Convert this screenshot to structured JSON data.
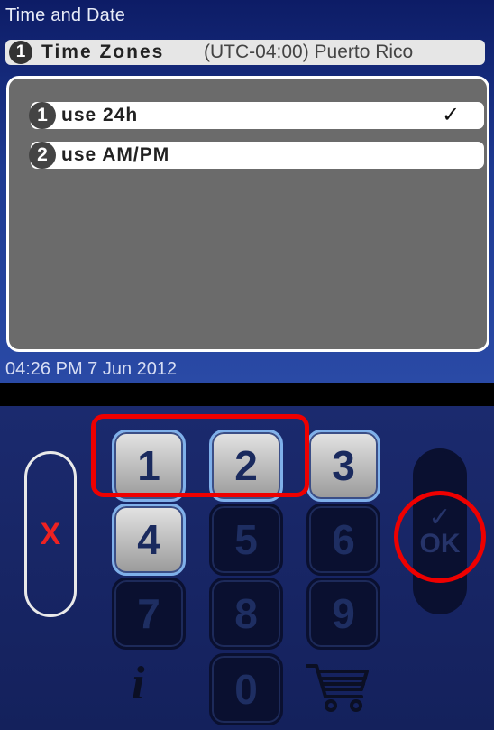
{
  "header": {
    "title": "Time and Date"
  },
  "timezone": {
    "number": "1",
    "label": "Time Zones",
    "value": "(UTC-04:00) Puerto Rico"
  },
  "dialog": {
    "options": [
      {
        "number": "1",
        "label": "use 24h",
        "checked": true,
        "check": "✓"
      },
      {
        "number": "2",
        "label": "use AM/PM",
        "checked": false
      }
    ]
  },
  "status": {
    "datetime": "04:26 PM 7 Jun 2012"
  },
  "keypad": {
    "keys": {
      "k1": "1",
      "k2": "2",
      "k3": "3",
      "k4": "4",
      "k5": "5",
      "k6": "6",
      "k7": "7",
      "k8": "8",
      "k9": "9",
      "k0": "0"
    },
    "active_keys": [
      "1",
      "2",
      "3",
      "4"
    ],
    "cancel_label": "X",
    "ok_tick": "✓",
    "ok_label": "OK",
    "info_label": "i"
  },
  "colors": {
    "highlight_ring": "#e00000",
    "cancel": "#e22222",
    "screen_bg": "#1e3a92"
  },
  "icons": [
    "cart-icon",
    "info-icon",
    "checkmark-icon"
  ]
}
